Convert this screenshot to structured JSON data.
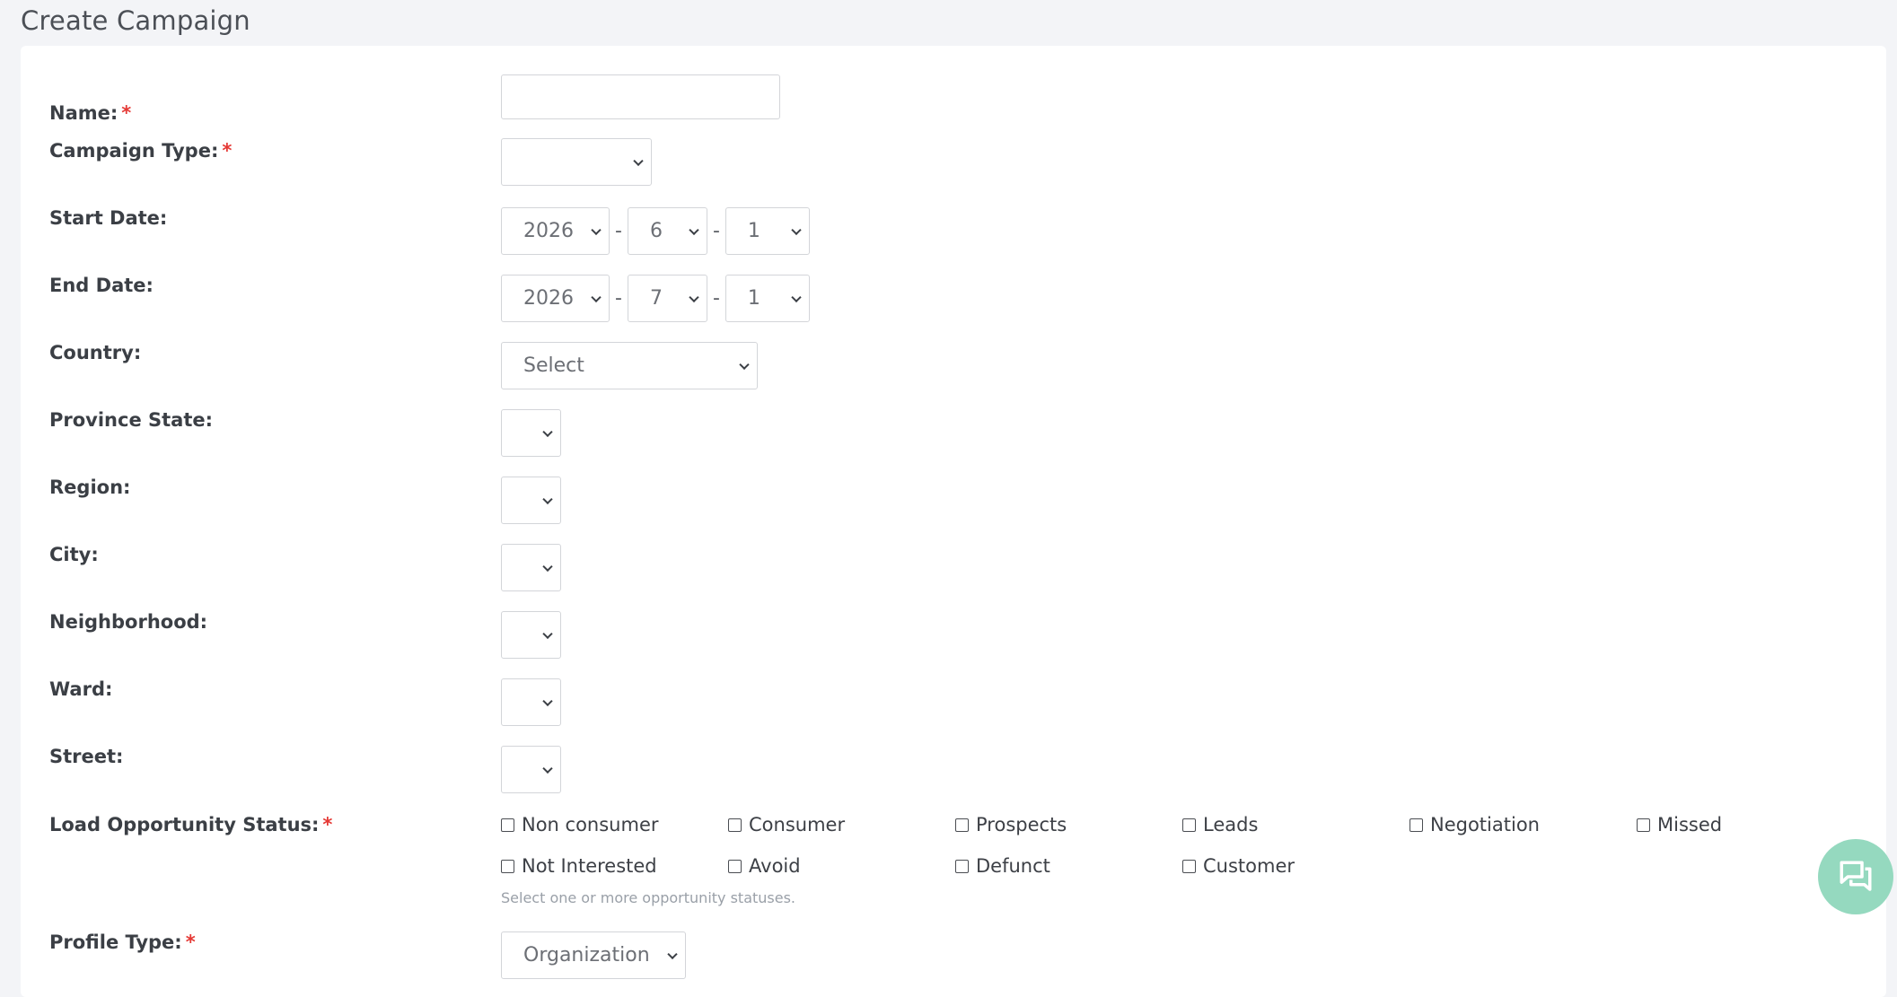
{
  "page": {
    "title": "Create Campaign"
  },
  "form": {
    "name": {
      "label": "Name:",
      "required": "*",
      "value": ""
    },
    "campaign_type": {
      "label": "Campaign Type:",
      "required": "*",
      "value": ""
    },
    "start_date": {
      "label": "Start Date:",
      "year": "2026",
      "month": "6",
      "day": "1"
    },
    "end_date": {
      "label": "End Date:",
      "year": "2026",
      "month": "7",
      "day": "1"
    },
    "separator": "-",
    "country": {
      "label": "Country:",
      "value": "Select"
    },
    "province_state": {
      "label": "Province State:",
      "value": ""
    },
    "region": {
      "label": "Region:",
      "value": ""
    },
    "city": {
      "label": "City:",
      "value": ""
    },
    "neighborhood": {
      "label": "Neighborhood:",
      "value": ""
    },
    "ward": {
      "label": "Ward:",
      "value": ""
    },
    "street": {
      "label": "Street:",
      "value": ""
    },
    "opportunity_status": {
      "label": "Load Opportunity Status:",
      "required": "*",
      "options": [
        "Non consumer",
        "Consumer",
        "Prospects",
        "Leads",
        "Negotiation",
        "Missed",
        "Not Interested",
        "Avoid",
        "Defunct",
        "Customer"
      ],
      "help": "Select one or more opportunity statuses."
    },
    "profile_type": {
      "label": "Profile Type:",
      "required": "*",
      "value": "Organization"
    }
  },
  "icons": {
    "select_arrow": "chevron-down-icon",
    "chat": "chat-icon"
  },
  "colors": {
    "required": "#e53935",
    "chat_button": "#95d9bf",
    "background": "#f3f4f7"
  }
}
